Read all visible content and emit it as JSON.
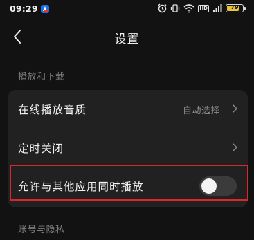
{
  "status_bar": {
    "time": "09:29",
    "network_badge": "HD",
    "battery_level": "79",
    "battery_percent": 79,
    "battery_color": "#e7c23a",
    "icons": [
      "app-notification-icon",
      "alarm-icon",
      "vibrate-icon",
      "wifi-icon",
      "hd-badge",
      "signal-icon",
      "battery-icon"
    ]
  },
  "header": {
    "back_icon": "chevron-left-icon",
    "title": "设置"
  },
  "sections": {
    "playback": {
      "title": "播放和下载",
      "items": [
        {
          "label": "在线播放音质",
          "value": "自动选择",
          "trailing_icon": "chevron-right-icon"
        },
        {
          "label": "定时关闭",
          "trailing_icon": "chevron-right-icon"
        },
        {
          "label": "允许与其他应用同时播放",
          "toggle_on": false
        }
      ]
    },
    "account": {
      "title": "账号与隐私"
    }
  },
  "colors": {
    "background": "#121212",
    "card": "#212121",
    "highlight": "#d9272e",
    "toggle_off_track": "#3b3b3b"
  }
}
